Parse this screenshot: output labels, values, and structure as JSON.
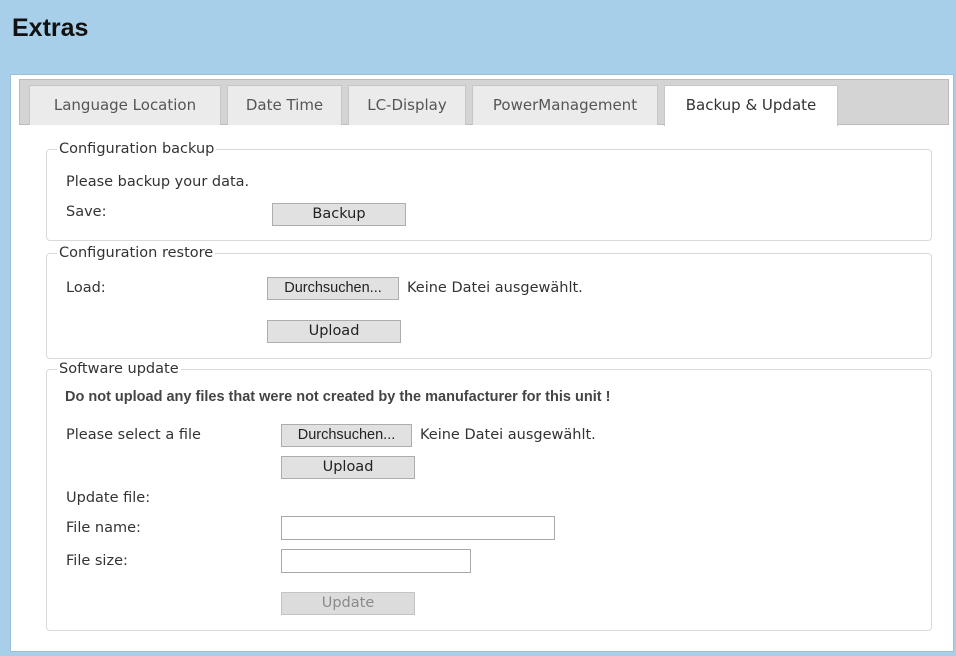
{
  "page": {
    "title": "Extras"
  },
  "tabs": [
    {
      "label": "Language Location",
      "active": false
    },
    {
      "label": "Date Time",
      "active": false
    },
    {
      "label": "LC-Display",
      "active": false
    },
    {
      "label": "PowerManagement",
      "active": false
    },
    {
      "label": "Backup & Update",
      "active": true
    }
  ],
  "backup": {
    "legend": "Configuration backup",
    "info": "Please backup your data.",
    "save_label": "Save:",
    "backup_button": "Backup"
  },
  "restore": {
    "legend": "Configuration restore",
    "load_label": "Load:",
    "browse_button": "Durchsuchen...",
    "no_file": "Keine Datei ausgewählt.",
    "upload_button": "Upload"
  },
  "software": {
    "legend": "Software update",
    "warning": "Do not upload any files that were not created by the manufacturer for this unit !",
    "select_label": "Please select a file",
    "browse_button": "Durchsuchen...",
    "no_file": "Keine Datei ausgewählt.",
    "upload_button": "Upload",
    "update_file_label": "Update file:",
    "file_name_label": "File name:",
    "file_name_value": "",
    "file_size_label": "File size:",
    "file_size_value": "",
    "update_button": "Update",
    "update_disabled": true
  },
  "colors": {
    "page_background": "#a7cfe9",
    "panel_background": "#ffffff",
    "tab_bar": "#d4d4d4",
    "button_face": "#e1e1e1"
  }
}
